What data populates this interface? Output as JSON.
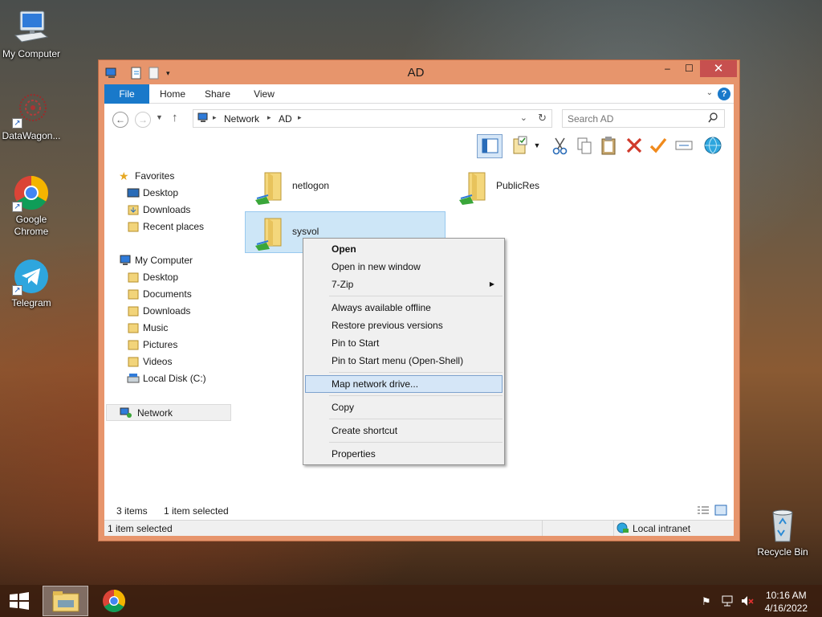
{
  "desktop": {
    "icons": [
      {
        "label": "My Computer",
        "icon": "computer-icon"
      },
      {
        "label": "DataWagon...",
        "icon": "datawagon-icon"
      },
      {
        "label": "Google Chrome",
        "icon": "chrome-icon"
      },
      {
        "label": "Telegram",
        "icon": "telegram-icon"
      },
      {
        "label": "Recycle Bin",
        "icon": "recycle-bin-icon"
      }
    ]
  },
  "window": {
    "title": "AD",
    "controls": {
      "minimize": "–",
      "maximize": "☐",
      "close": "✕"
    }
  },
  "ribbon": {
    "tabs": [
      "File",
      "Home",
      "Share",
      "View"
    ],
    "help": "?"
  },
  "address": {
    "breadcrumb": [
      "Network",
      "AD"
    ],
    "search_placeholder": "Search AD"
  },
  "navpane": {
    "favorites_header": "Favorites",
    "favorites": [
      "Desktop",
      "Downloads",
      "Recent places"
    ],
    "computer_header": "My Computer",
    "computer": [
      "Desktop",
      "Documents",
      "Downloads",
      "Music",
      "Pictures",
      "Videos",
      "Local Disk (C:)"
    ],
    "network": "Network"
  },
  "folders": [
    {
      "name": "netlogon"
    },
    {
      "name": "PublicRes"
    },
    {
      "name": "sysvol",
      "selected": true
    }
  ],
  "context_menu": {
    "items": [
      {
        "label": "Open",
        "bold": true
      },
      {
        "label": "Open in new window"
      },
      {
        "label": "7-Zip",
        "submenu": true
      },
      {
        "label": "Always available offline"
      },
      {
        "label": "Restore previous versions"
      },
      {
        "label": "Pin to Start"
      },
      {
        "label": "Pin to Start menu (Open-Shell)"
      },
      {
        "label": "Map network drive...",
        "highlighted": true
      },
      {
        "label": "Copy"
      },
      {
        "label": "Create shortcut"
      },
      {
        "label": "Properties"
      }
    ]
  },
  "status": {
    "item_count": "3 items",
    "selected": "1 item selected",
    "bottom_selected": "1 item selected",
    "zone": "Local intranet"
  },
  "taskbar": {
    "time": "10:16 AM",
    "date": "4/16/2022"
  },
  "colors": {
    "title_bar": "#e7956c",
    "file_tab": "#1979ca",
    "selection": "#cde6f7",
    "close_button": "#c7504f"
  }
}
